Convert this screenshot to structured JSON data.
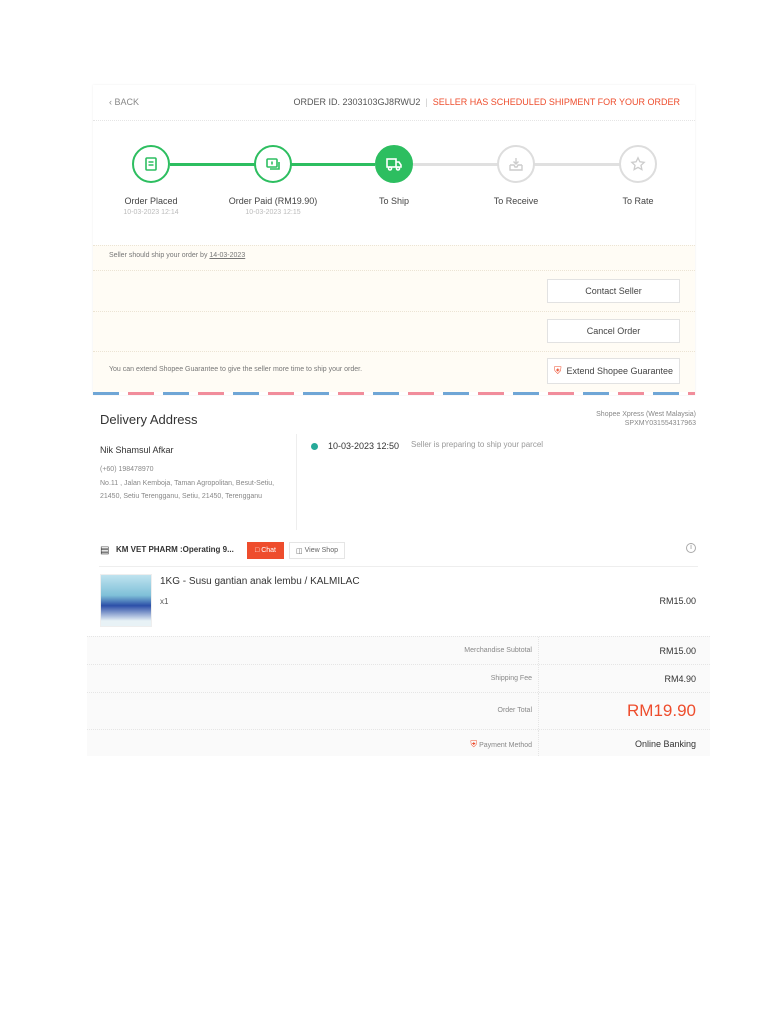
{
  "header": {
    "back_label": "BACK",
    "order_id_label": "ORDER ID. 2303103GJ8RWU2",
    "separator": "|",
    "status": "SELLER HAS SCHEDULED SHIPMENT FOR YOUR ORDER"
  },
  "steps": [
    {
      "label": "Order Placed",
      "date": "10-03-2023 12:14",
      "icon": "receipt-icon",
      "state": "done"
    },
    {
      "label": "Order Paid (RM19.90)",
      "date": "10-03-2023 12:15",
      "icon": "money-icon",
      "state": "done"
    },
    {
      "label": "To Ship",
      "date": "",
      "icon": "truck-icon",
      "state": "current"
    },
    {
      "label": "To Receive",
      "date": "",
      "icon": "inbox-icon",
      "state": "pending"
    },
    {
      "label": "To Rate",
      "date": "",
      "icon": "star-icon",
      "state": "pending"
    }
  ],
  "ship_notice": {
    "text": "Seller should ship your order by",
    "date": "14-03-2023"
  },
  "actions": {
    "contact_seller": "Contact Seller",
    "cancel_order": "Cancel Order",
    "extend": "Extend Shopee Guarantee",
    "extend_note": "You can extend Shopee Guarantee to give the seller more time to ship your order."
  },
  "delivery": {
    "title": "Delivery Address",
    "courier": "Shopee Xpress (West Malaysia)",
    "tracking": "SPXMY031554317963",
    "name": "Nik Shamsul Afkar",
    "phone": "(+60) 198478970",
    "address": "No.11 , Jalan Kemboja, Taman Agropolitan, Besut-Setiu, 21450, Setiu Terengganu, Setiu, 21450, Terengganu",
    "event_time": "10-03-2023 12:50",
    "event_text": "Seller is preparing to ship your parcel"
  },
  "shop": {
    "name": "KM VET PHARM :Operating 9...",
    "chat": "Chat",
    "view_shop": "View Shop"
  },
  "item": {
    "name": "1KG - Susu gantian anak lembu / KALMILAC",
    "qty": "x1",
    "price": "RM15.00"
  },
  "summary": {
    "subtotal_label": "Merchandise Subtotal",
    "subtotal": "RM15.00",
    "shipping_label": "Shipping Fee",
    "shipping": "RM4.90",
    "total_label": "Order Total",
    "total": "RM19.90",
    "payment_label": "Payment Method",
    "payment": "Online Banking"
  },
  "colors": {
    "accent": "#ee4d2d",
    "green": "#2dbe60",
    "teal": "#26aa99"
  }
}
